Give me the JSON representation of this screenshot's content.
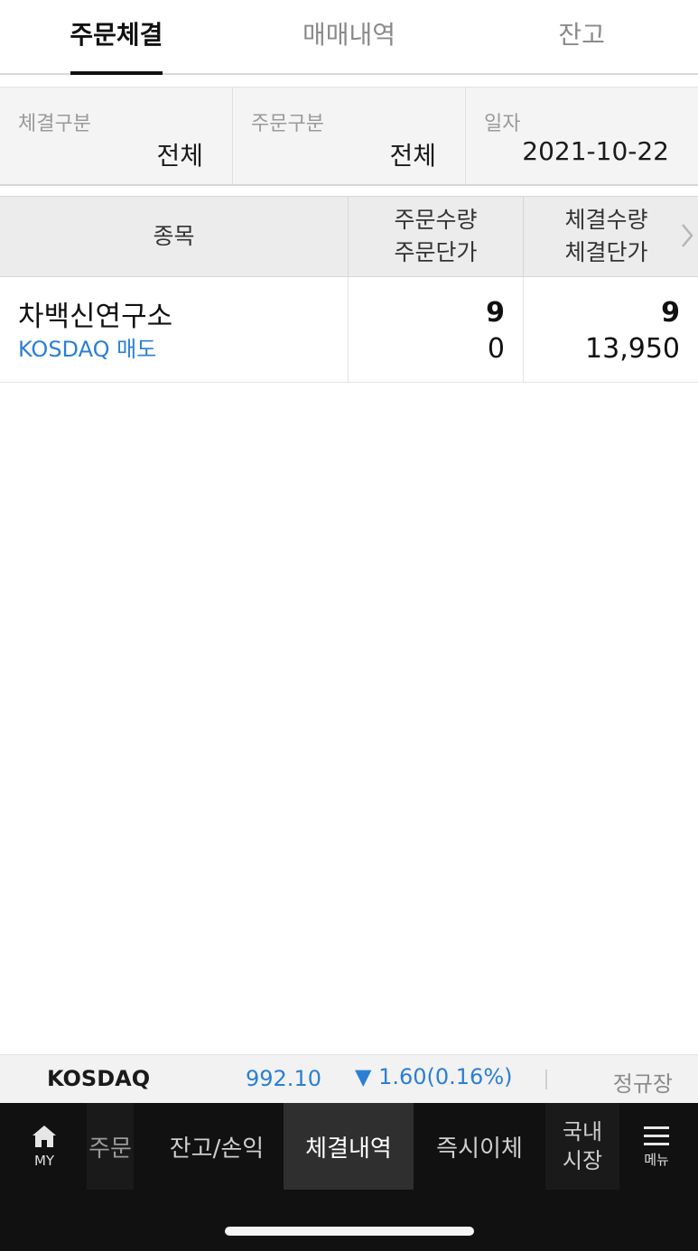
{
  "tabs": [
    {
      "label": "주문체결",
      "active": true
    },
    {
      "label": "매매내역",
      "active": false
    },
    {
      "label": "잔고",
      "active": false
    }
  ],
  "filters": [
    {
      "label": "체결구분",
      "value": "전체"
    },
    {
      "label": "주문구분",
      "value": "전체"
    },
    {
      "label": "일자",
      "value": "2021-10-22"
    }
  ],
  "table": {
    "headers": {
      "col1": "종목",
      "col2_line1": "주문수량",
      "col2_line2": "주문단가",
      "col3_line1": "체결수량",
      "col3_line2": "체결단가"
    },
    "rows": [
      {
        "name": "차백신연구소",
        "sub": "KOSDAQ 매도",
        "order_qty": "9",
        "order_price": "0",
        "exec_qty": "9",
        "exec_price": "13,950"
      }
    ]
  },
  "ticker": {
    "name": "KOSDAQ",
    "price": "992.10",
    "change": "▼ 1.60(0.16%)",
    "status": "정규장",
    "color": "#2a7fd4"
  },
  "bottom_nav": {
    "my": "MY",
    "order": "주문",
    "balance": "잔고/손익",
    "history": "체결내역",
    "transfer": "즉시이체",
    "domestic_line1": "국내",
    "domestic_line2": "시장",
    "menu": "메뉴"
  }
}
